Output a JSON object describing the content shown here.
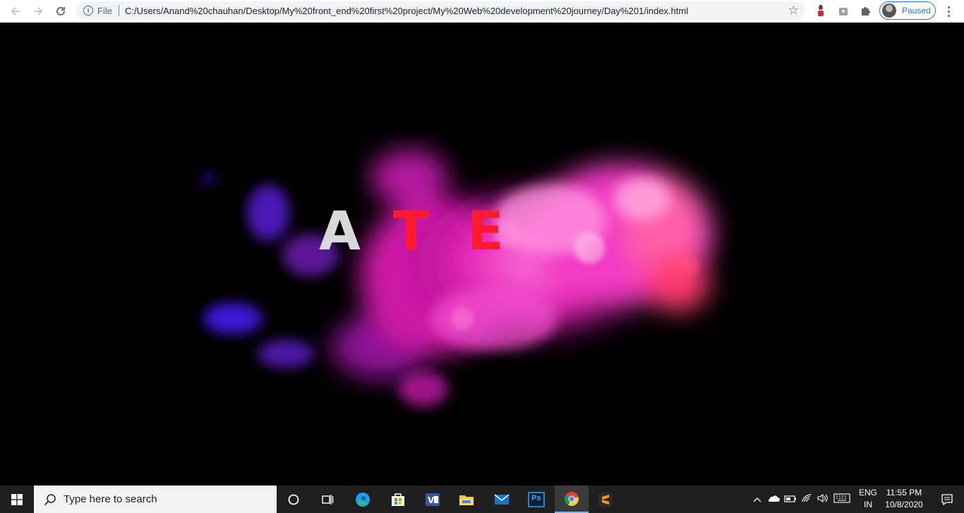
{
  "browser": {
    "back_icon": "arrow-left-icon",
    "forward_icon": "arrow-right-icon",
    "reload_icon": "reload-icon",
    "security_label": "File",
    "url": "C:/Users/Anand%20chauhan/Desktop/My%20front_end%20first%20project/My%20Web%20development%20journey/Day%201/index.html",
    "profile_status": "Paused",
    "accent_color": "#1a73e8"
  },
  "page": {
    "background_color": "#000000",
    "letters": [
      {
        "char": "A",
        "color": "#d9d9d9"
      },
      {
        "char": "T",
        "color": "#ff1a2e"
      },
      {
        "char": "E",
        "color": "#ff1a2e"
      }
    ]
  },
  "taskbar": {
    "search_placeholder": "Type here to search",
    "apps": [
      "cortana-icon",
      "task-view-icon",
      "edge-icon",
      "store-icon",
      "visio-icon",
      "file-explorer-icon",
      "mail-icon",
      "photoshop-icon",
      "chrome-icon",
      "sublime-text-icon"
    ],
    "photoshop_label": "Ps",
    "lang_top": "ENG",
    "lang_bottom": "IN",
    "time": "11:55 PM",
    "date": "10/8/2020"
  }
}
